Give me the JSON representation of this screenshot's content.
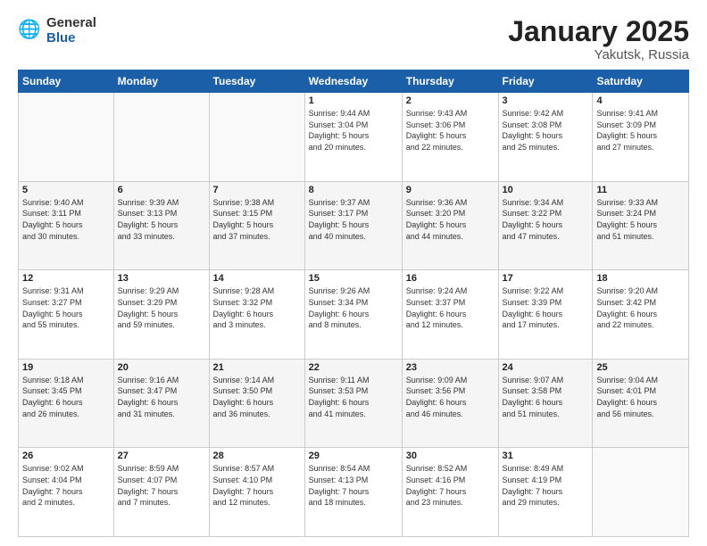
{
  "logo": {
    "general": "General",
    "blue": "Blue"
  },
  "title": "January 2025",
  "subtitle": "Yakutsk, Russia",
  "headers": [
    "Sunday",
    "Monday",
    "Tuesday",
    "Wednesday",
    "Thursday",
    "Friday",
    "Saturday"
  ],
  "weeks": [
    [
      {
        "day": "",
        "info": ""
      },
      {
        "day": "",
        "info": ""
      },
      {
        "day": "",
        "info": ""
      },
      {
        "day": "1",
        "info": "Sunrise: 9:44 AM\nSunset: 3:04 PM\nDaylight: 5 hours\nand 20 minutes."
      },
      {
        "day": "2",
        "info": "Sunrise: 9:43 AM\nSunset: 3:06 PM\nDaylight: 5 hours\nand 22 minutes."
      },
      {
        "day": "3",
        "info": "Sunrise: 9:42 AM\nSunset: 3:08 PM\nDaylight: 5 hours\nand 25 minutes."
      },
      {
        "day": "4",
        "info": "Sunrise: 9:41 AM\nSunset: 3:09 PM\nDaylight: 5 hours\nand 27 minutes."
      }
    ],
    [
      {
        "day": "5",
        "info": "Sunrise: 9:40 AM\nSunset: 3:11 PM\nDaylight: 5 hours\nand 30 minutes."
      },
      {
        "day": "6",
        "info": "Sunrise: 9:39 AM\nSunset: 3:13 PM\nDaylight: 5 hours\nand 33 minutes."
      },
      {
        "day": "7",
        "info": "Sunrise: 9:38 AM\nSunset: 3:15 PM\nDaylight: 5 hours\nand 37 minutes."
      },
      {
        "day": "8",
        "info": "Sunrise: 9:37 AM\nSunset: 3:17 PM\nDaylight: 5 hours\nand 40 minutes."
      },
      {
        "day": "9",
        "info": "Sunrise: 9:36 AM\nSunset: 3:20 PM\nDaylight: 5 hours\nand 44 minutes."
      },
      {
        "day": "10",
        "info": "Sunrise: 9:34 AM\nSunset: 3:22 PM\nDaylight: 5 hours\nand 47 minutes."
      },
      {
        "day": "11",
        "info": "Sunrise: 9:33 AM\nSunset: 3:24 PM\nDaylight: 5 hours\nand 51 minutes."
      }
    ],
    [
      {
        "day": "12",
        "info": "Sunrise: 9:31 AM\nSunset: 3:27 PM\nDaylight: 5 hours\nand 55 minutes."
      },
      {
        "day": "13",
        "info": "Sunrise: 9:29 AM\nSunset: 3:29 PM\nDaylight: 5 hours\nand 59 minutes."
      },
      {
        "day": "14",
        "info": "Sunrise: 9:28 AM\nSunset: 3:32 PM\nDaylight: 6 hours\nand 3 minutes."
      },
      {
        "day": "15",
        "info": "Sunrise: 9:26 AM\nSunset: 3:34 PM\nDaylight: 6 hours\nand 8 minutes."
      },
      {
        "day": "16",
        "info": "Sunrise: 9:24 AM\nSunset: 3:37 PM\nDaylight: 6 hours\nand 12 minutes."
      },
      {
        "day": "17",
        "info": "Sunrise: 9:22 AM\nSunset: 3:39 PM\nDaylight: 6 hours\nand 17 minutes."
      },
      {
        "day": "18",
        "info": "Sunrise: 9:20 AM\nSunset: 3:42 PM\nDaylight: 6 hours\nand 22 minutes."
      }
    ],
    [
      {
        "day": "19",
        "info": "Sunrise: 9:18 AM\nSunset: 3:45 PM\nDaylight: 6 hours\nand 26 minutes."
      },
      {
        "day": "20",
        "info": "Sunrise: 9:16 AM\nSunset: 3:47 PM\nDaylight: 6 hours\nand 31 minutes."
      },
      {
        "day": "21",
        "info": "Sunrise: 9:14 AM\nSunset: 3:50 PM\nDaylight: 6 hours\nand 36 minutes."
      },
      {
        "day": "22",
        "info": "Sunrise: 9:11 AM\nSunset: 3:53 PM\nDaylight: 6 hours\nand 41 minutes."
      },
      {
        "day": "23",
        "info": "Sunrise: 9:09 AM\nSunset: 3:56 PM\nDaylight: 6 hours\nand 46 minutes."
      },
      {
        "day": "24",
        "info": "Sunrise: 9:07 AM\nSunset: 3:58 PM\nDaylight: 6 hours\nand 51 minutes."
      },
      {
        "day": "25",
        "info": "Sunrise: 9:04 AM\nSunset: 4:01 PM\nDaylight: 6 hours\nand 56 minutes."
      }
    ],
    [
      {
        "day": "26",
        "info": "Sunrise: 9:02 AM\nSunset: 4:04 PM\nDaylight: 7 hours\nand 2 minutes."
      },
      {
        "day": "27",
        "info": "Sunrise: 8:59 AM\nSunset: 4:07 PM\nDaylight: 7 hours\nand 7 minutes."
      },
      {
        "day": "28",
        "info": "Sunrise: 8:57 AM\nSunset: 4:10 PM\nDaylight: 7 hours\nand 12 minutes."
      },
      {
        "day": "29",
        "info": "Sunrise: 8:54 AM\nSunset: 4:13 PM\nDaylight: 7 hours\nand 18 minutes."
      },
      {
        "day": "30",
        "info": "Sunrise: 8:52 AM\nSunset: 4:16 PM\nDaylight: 7 hours\nand 23 minutes."
      },
      {
        "day": "31",
        "info": "Sunrise: 8:49 AM\nSunset: 4:19 PM\nDaylight: 7 hours\nand 29 minutes."
      },
      {
        "day": "",
        "info": ""
      }
    ]
  ]
}
